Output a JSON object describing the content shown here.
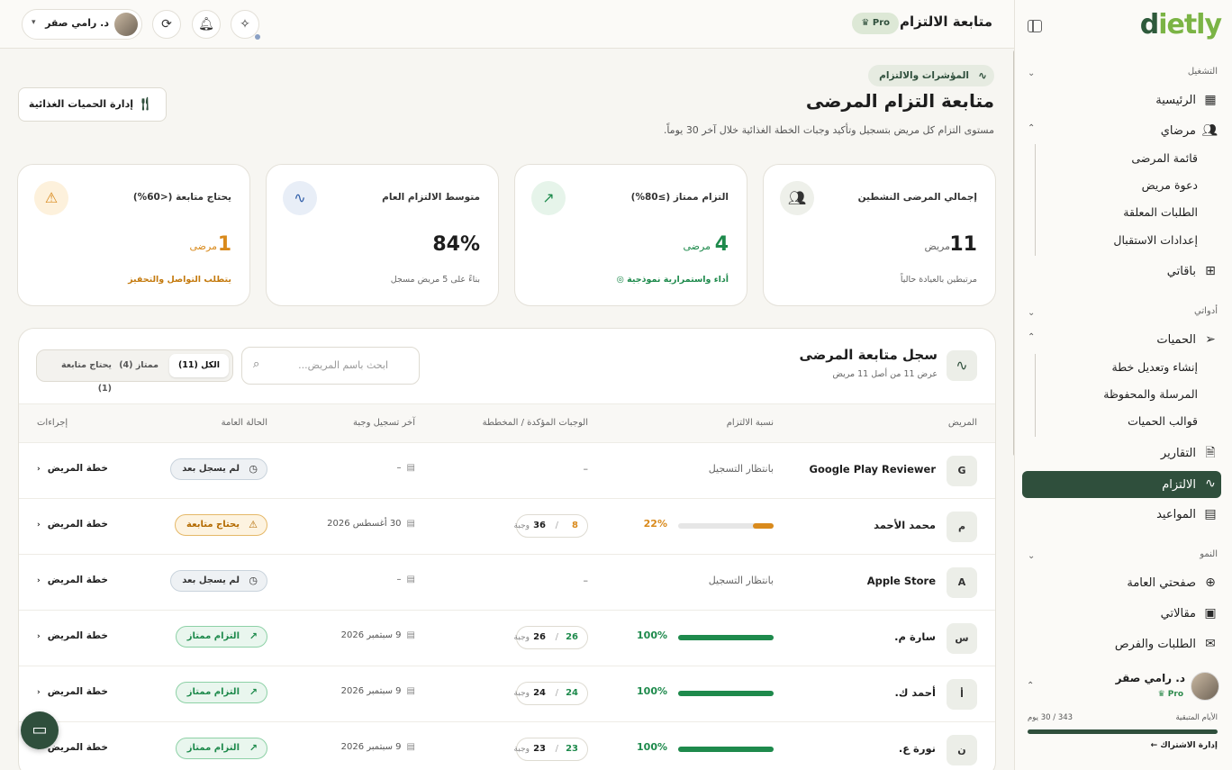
{
  "app": {
    "logo_prefix": "d",
    "logo_rest": "ietly"
  },
  "topbar": {
    "page_title": "متابعة الالتزام",
    "pro_label": "Pro ♛",
    "user_name": "د. رامي صقر"
  },
  "sidebar": {
    "section_operations": "التشغيل",
    "home": "الرئيسية",
    "my_patients": "مرضاي",
    "patients_sub": [
      "قائمة المرضى",
      "دعوة مريض",
      "الطلبات المعلقة",
      "إعدادات الاستقبال"
    ],
    "packages": "باقاتي",
    "section_tools": "أدواتي",
    "diets": "الحميات",
    "diets_sub": [
      "إنشاء وتعديل خطة",
      "المرسلة والمحفوظة",
      "قوالب الحميات"
    ],
    "reports": "التقارير",
    "adherence": "الالتزام",
    "appointments": "المواعيد",
    "section_growth": "النمو",
    "public_page": "صفحتي العامة",
    "articles": "مقالاتي",
    "requests": "الطلبات والفرص",
    "user_name": "د. رامي صقر",
    "user_plan": "Pro ♛",
    "days_label": "الأيام المتبقية",
    "days_value": "343 / 30 يوم",
    "manage_sub": "إدارة الاشتراك ←"
  },
  "header": {
    "badge": "المؤشرات والالتزام",
    "title": "متابعة التزام المرضى",
    "subtitle": "مستوى التزام كل مريض بتسجيل وتأكيد وجبات الخطة الغذائية خلال آخر 30 يوماً.",
    "diet_button": "إدارة الحميات الغذائية"
  },
  "stats": [
    {
      "label": "إجمالي المرضى النشطين",
      "value": "11",
      "unit": "مريض",
      "foot": "مرتبطين بالعيادة حالياً",
      "color": "#1d1d1d"
    },
    {
      "label": "التزام ممتاز (≥80%)",
      "value": "4",
      "unit": "مرضى",
      "foot": "أداء واستمرارية نموذجية",
      "color": "#1e8a4c"
    },
    {
      "label": "متوسط الالتزام العام",
      "value": "84%",
      "unit": "",
      "foot": "بناءً على 5 مريض مسجل",
      "color": "#1d1d1d"
    },
    {
      "label": "يحتاج متابعة (<60%)",
      "value": "1",
      "unit": "مرضى",
      "foot": "يتطلب التواصل والتحفيز",
      "color": "#d98a1c"
    }
  ],
  "table": {
    "title": "سجل متابعة المرضى",
    "subtitle": "عرض 11 من أصل 11 مريض",
    "search_placeholder": "ابحث باسم المريض...",
    "filters": [
      "الكل (11)",
      "ممتاز (4)",
      "يحتاج متابعة (1)"
    ],
    "headers": [
      "المريض",
      "نسبة الالتزام",
      "الوجبات المؤكدة / المخططة",
      "آخر تسجيل وجبة",
      "الحالة العامة",
      "إجراءات"
    ],
    "plan_label": "خطة المريض",
    "pending_label": "بانتظار التسجيل",
    "meals_unit": "وجبة",
    "rows": [
      {
        "initial": "G",
        "name": "Google Play Reviewer",
        "pending": true,
        "pct": null,
        "confirmed": "",
        "planned": "",
        "date": "–",
        "status": "لم يسجل بعد",
        "status_type": "none"
      },
      {
        "initial": "م",
        "name": "محمد الأحمد",
        "pending": false,
        "pct": 22,
        "pct_label": "22%",
        "confirmed": "8",
        "planned": "36",
        "date": "30 أغسطس 2026",
        "status": "يحتاج متابعة",
        "status_type": "warn"
      },
      {
        "initial": "A",
        "name": "Apple Store",
        "pending": true,
        "pct": null,
        "confirmed": "",
        "planned": "",
        "date": "–",
        "status": "لم يسجل بعد",
        "status_type": "none"
      },
      {
        "initial": "س",
        "name": "سارة م.",
        "pending": false,
        "pct": 100,
        "pct_label": "100%",
        "confirmed": "26",
        "planned": "26",
        "date": "9 سبتمبر 2026",
        "status": "التزام ممتاز",
        "status_type": "good"
      },
      {
        "initial": "أ",
        "name": "أحمد ك.",
        "pending": false,
        "pct": 100,
        "pct_label": "100%",
        "confirmed": "24",
        "planned": "24",
        "date": "9 سبتمبر 2026",
        "status": "التزام ممتاز",
        "status_type": "good"
      },
      {
        "initial": "ن",
        "name": "نورة ع.",
        "pending": false,
        "pct": 100,
        "pct_label": "100%",
        "confirmed": "23",
        "planned": "23",
        "date": "9 سبتمبر 2026",
        "status": "التزام ممتاز",
        "status_type": "good"
      }
    ]
  }
}
